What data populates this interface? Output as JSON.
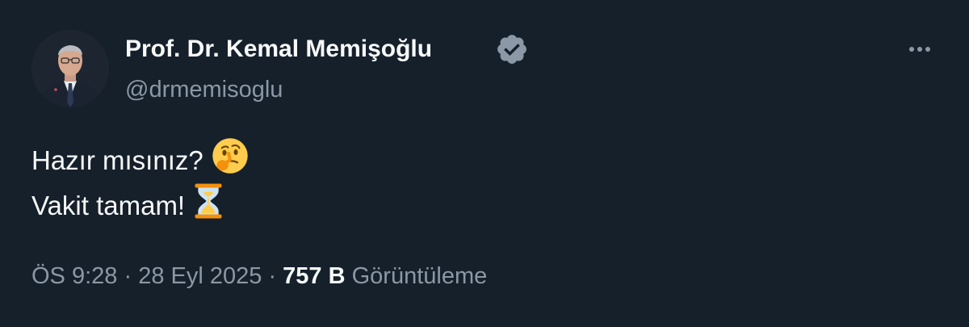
{
  "author": {
    "display_name": "Prof. Dr. Kemal Memişoğlu",
    "handle": "@drmemisoglu",
    "verified": true,
    "avatar_icon": "profile-photo"
  },
  "tweet": {
    "lines": [
      {
        "text": "Hazır mısınız?",
        "emoji_icon": "thinking-face-icon"
      },
      {
        "text": "Vakit tamam!",
        "emoji_icon": "hourglass-icon"
      }
    ]
  },
  "meta": {
    "time": "ÖS 9:28",
    "separator": "·",
    "date": "28 Eyl 2025",
    "views_count": "757 B",
    "views_label": "Görüntüleme"
  },
  "actions": {
    "more_icon": "more-horizontal-icon"
  },
  "colors": {
    "background": "#15202b",
    "primary_text": "#f7f9f9",
    "secondary_text": "#8b98a5",
    "verified_badge": "#8b98a5"
  }
}
